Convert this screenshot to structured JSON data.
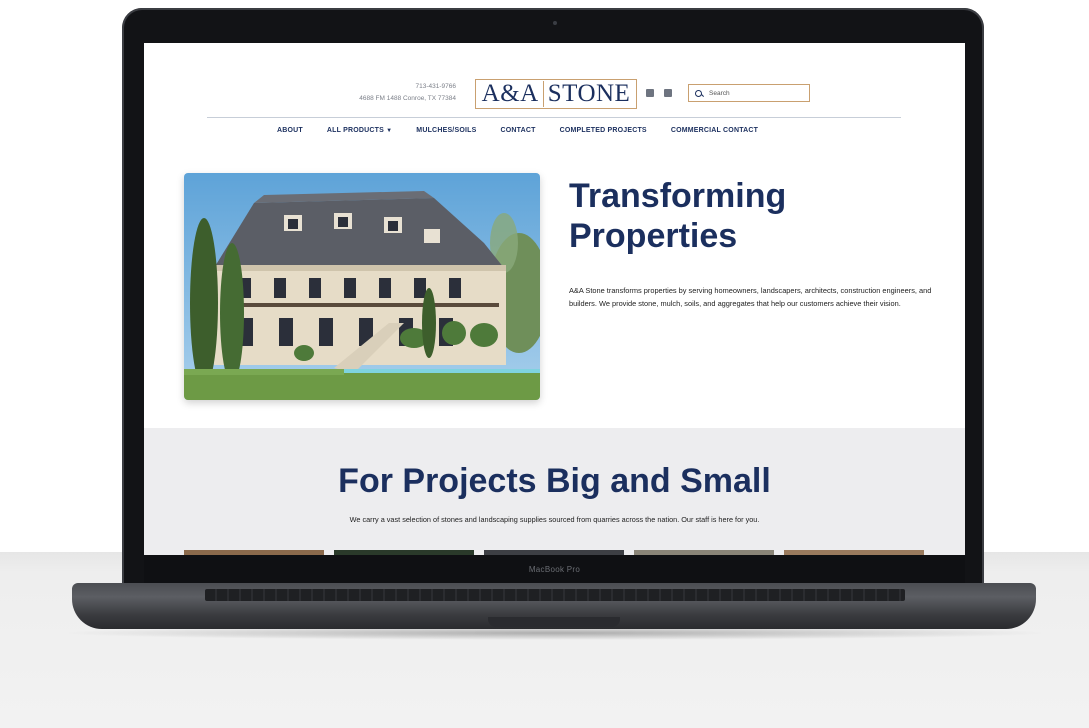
{
  "device": {
    "model_label": "MacBook Pro"
  },
  "site": {
    "contact": {
      "phone": "713-431-9766",
      "address": "4688 FM 1488 Conroe, TX 77384"
    },
    "logo": {
      "left": "A&A",
      "right": "STONE"
    },
    "social_icons": [
      "facebook-icon",
      "instagram-icon"
    ],
    "search": {
      "placeholder": "Search",
      "value": ""
    },
    "nav": [
      {
        "label": "ABOUT"
      },
      {
        "label": "ALL PRODUCTS",
        "has_dropdown": true
      },
      {
        "label": "MULCHES/SOILS"
      },
      {
        "label": "CONTACT"
      },
      {
        "label": "COMPLETED PROJECTS"
      },
      {
        "label": "COMMERCIAL CONTACT"
      }
    ],
    "hero": {
      "title_line1": "Transforming",
      "title_line2": "Properties",
      "text": "A&A Stone transforms properties by serving homeowners, landscapers, architects, construction engineers, and builders. We provide stone, mulch, soils, and aggregates that help our customers achieve their vision."
    },
    "projects": {
      "title": "For Projects Big and Small",
      "text": "We carry a vast selection of stones and landscaping supplies sourced from quarries across the nation. Our staff is here for you."
    }
  },
  "colors": {
    "brand_navy": "#1b2f5e",
    "accent_tan": "#c9a070",
    "band_grey": "#ededef"
  }
}
